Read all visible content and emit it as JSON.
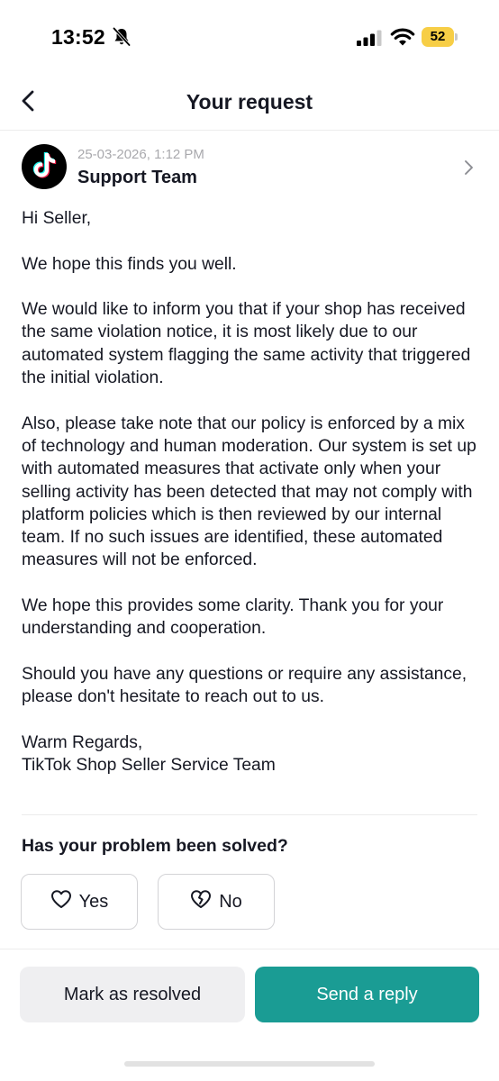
{
  "status_bar": {
    "time": "13:52",
    "battery": "52",
    "icons": [
      "bell-slash-icon",
      "cellular-signal-icon",
      "wifi-icon",
      "battery-icon"
    ]
  },
  "header": {
    "title": "Your request",
    "back_icon": "chevron-left-icon"
  },
  "message": {
    "date": "25-03-2026, 1:12 PM",
    "sender": "Support Team",
    "avatar_icon": "tiktok-logo-icon",
    "paragraphs": [
      "Hi Seller,",
      "We hope this finds you well.",
      "We would like to inform you that if your shop has received the same violation notice, it is most likely due to our automated system flagging the same activity that triggered the initial violation.",
      "Also, please take note that our policy is enforced by a mix of technology and human moderation. Our system is set up with automated measures that activate only when your selling activity has been detected that may not comply with platform policies which is then reviewed by our internal team. If no such issues are identified, these automated measures will not be enforced.",
      "We hope this provides some clarity. Thank you for your understanding and cooperation.",
      "Should you have any questions or require any assistance, please don't hesitate to reach out to us."
    ],
    "signoff": "Warm Regards,",
    "signature": "TikTok Shop Seller Service Team"
  },
  "feedback": {
    "question": "Has your problem been solved?",
    "yes_label": "Yes",
    "no_label": "No"
  },
  "actions": {
    "resolve_label": "Mark as resolved",
    "reply_label": "Send a reply"
  },
  "colors": {
    "accent": "#1a9c94",
    "secondary_button": "#efeff1",
    "battery": "#f7ce46",
    "muted_text": "#a9a9ad"
  }
}
